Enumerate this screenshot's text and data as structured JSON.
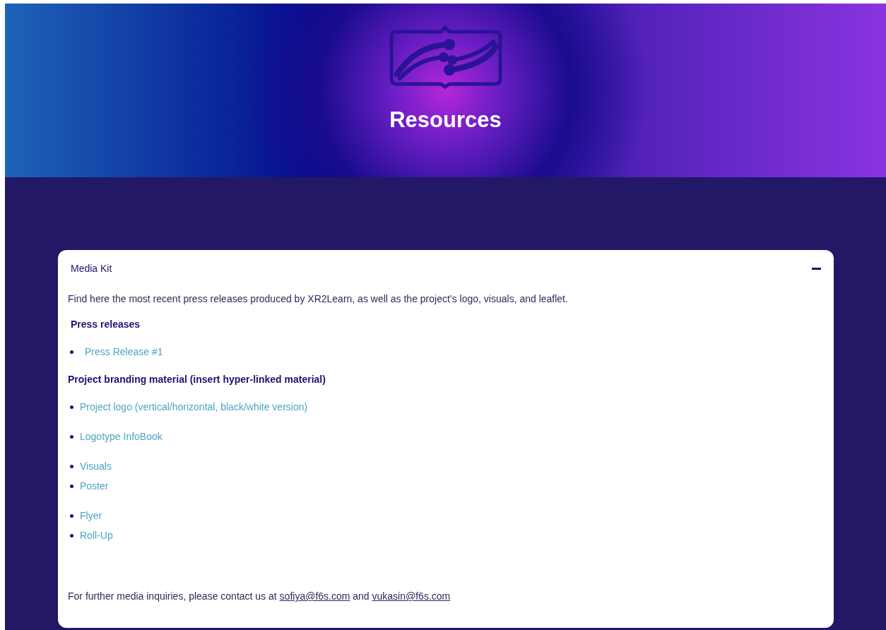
{
  "header": {
    "title": "Resources"
  },
  "accordion": {
    "title": "Media Kit",
    "expanded": true,
    "intro": "Find here the most recent press releases produced by XR2Learn, as well as the project’s logo, visuals, and leaflet.",
    "sections": [
      {
        "heading": "Press releases",
        "groups": [
          [
            "Press Release #1"
          ]
        ]
      },
      {
        "heading": "Project branding material (insert hyper-linked material)",
        "groups": [
          [
            "Project logo (vertical/horizontal, black/white version)"
          ],
          [
            "Logotype InfoBook"
          ],
          [
            "Visuals",
            "Poster"
          ],
          [
            "Flyer",
            "Roll-Up"
          ]
        ]
      }
    ],
    "contact": {
      "text": "For further media inquiries, please contact us at",
      "joiner": "and",
      "emails": [
        "sofiya@f6s.com",
        "vukasin@f6s.com"
      ]
    }
  }
}
